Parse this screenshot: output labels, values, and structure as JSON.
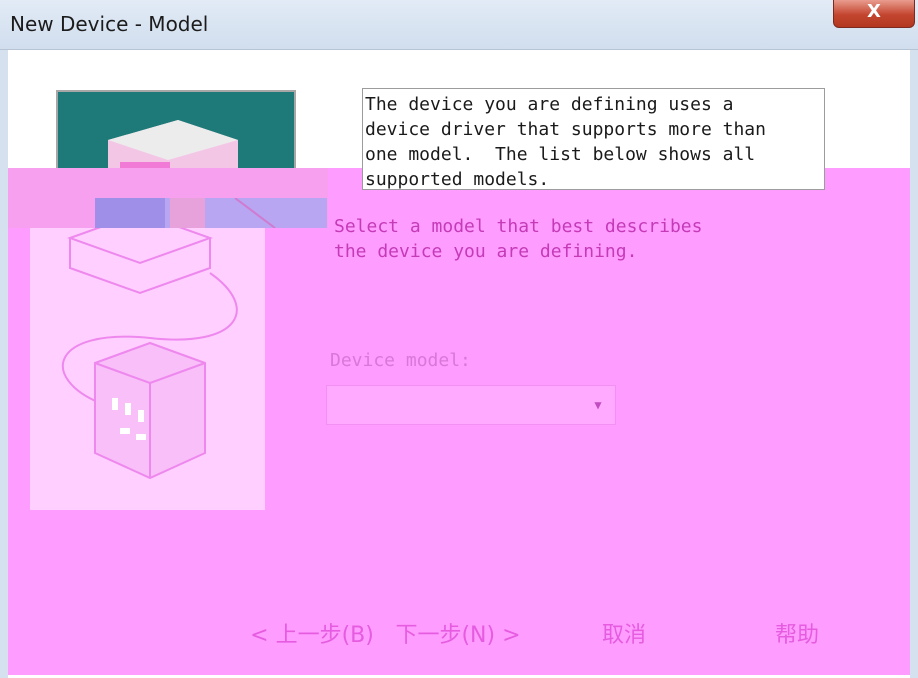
{
  "window": {
    "title": "New Device - Model",
    "close_label": "X"
  },
  "description": {
    "text": "The device you are defining uses a\ndevice driver that supports more than\none model.  The list below shows all\nsupported models."
  },
  "instruction": {
    "text": "Select a model that best describes\nthe device you are defining."
  },
  "device_model": {
    "label": "Device model:",
    "value": "",
    "arrow": "▼"
  },
  "footer": {
    "back_label": "< 上一步(B)",
    "next_label": "下一步(N) >",
    "cancel_label": "取消",
    "help_label": "帮助"
  },
  "colors": {
    "client_background": "#ff9cff",
    "titlebar": "#d6e1ef",
    "close_button": "#c3452f",
    "illustration_teal": "#1e7a78"
  },
  "icons": [
    "close-icon",
    "device-illustration-icon",
    "chevron-down-icon"
  ]
}
